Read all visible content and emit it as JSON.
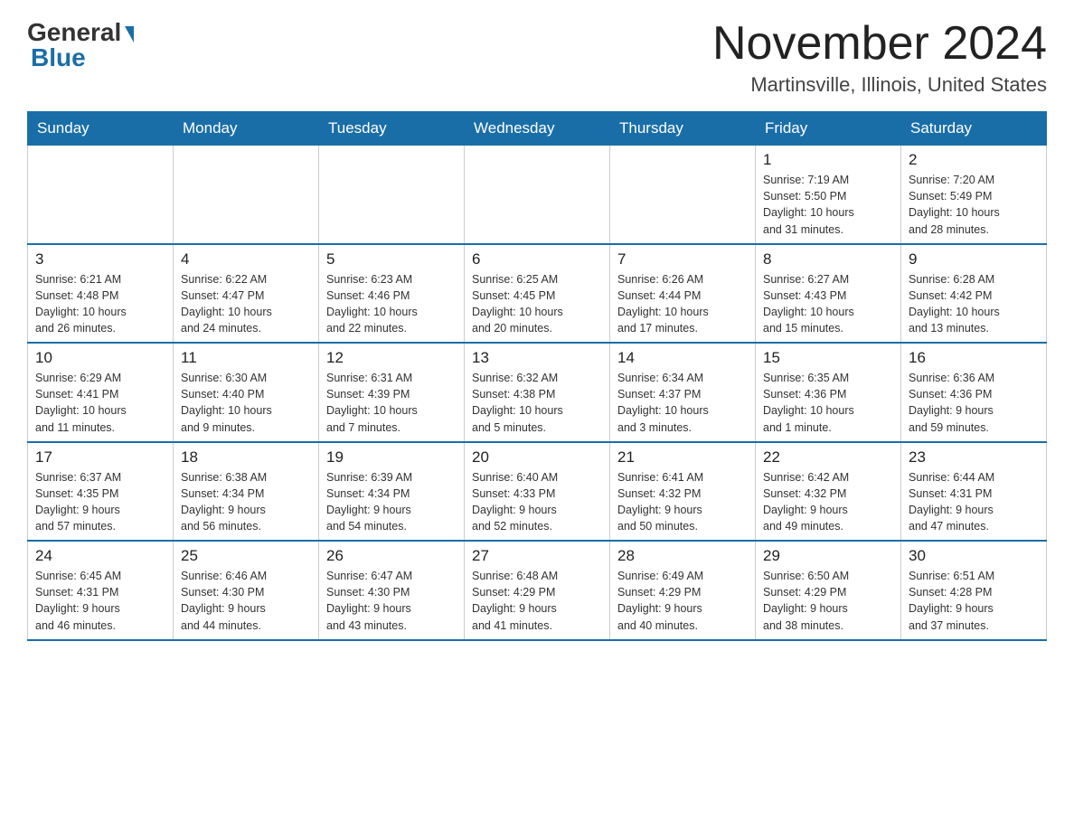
{
  "logo": {
    "general": "General",
    "blue": "Blue"
  },
  "header": {
    "month_year": "November 2024",
    "location": "Martinsville, Illinois, United States"
  },
  "weekdays": [
    "Sunday",
    "Monday",
    "Tuesday",
    "Wednesday",
    "Thursday",
    "Friday",
    "Saturday"
  ],
  "weeks": [
    [
      {
        "day": "",
        "info": ""
      },
      {
        "day": "",
        "info": ""
      },
      {
        "day": "",
        "info": ""
      },
      {
        "day": "",
        "info": ""
      },
      {
        "day": "",
        "info": ""
      },
      {
        "day": "1",
        "info": "Sunrise: 7:19 AM\nSunset: 5:50 PM\nDaylight: 10 hours\nand 31 minutes."
      },
      {
        "day": "2",
        "info": "Sunrise: 7:20 AM\nSunset: 5:49 PM\nDaylight: 10 hours\nand 28 minutes."
      }
    ],
    [
      {
        "day": "3",
        "info": "Sunrise: 6:21 AM\nSunset: 4:48 PM\nDaylight: 10 hours\nand 26 minutes."
      },
      {
        "day": "4",
        "info": "Sunrise: 6:22 AM\nSunset: 4:47 PM\nDaylight: 10 hours\nand 24 minutes."
      },
      {
        "day": "5",
        "info": "Sunrise: 6:23 AM\nSunset: 4:46 PM\nDaylight: 10 hours\nand 22 minutes."
      },
      {
        "day": "6",
        "info": "Sunrise: 6:25 AM\nSunset: 4:45 PM\nDaylight: 10 hours\nand 20 minutes."
      },
      {
        "day": "7",
        "info": "Sunrise: 6:26 AM\nSunset: 4:44 PM\nDaylight: 10 hours\nand 17 minutes."
      },
      {
        "day": "8",
        "info": "Sunrise: 6:27 AM\nSunset: 4:43 PM\nDaylight: 10 hours\nand 15 minutes."
      },
      {
        "day": "9",
        "info": "Sunrise: 6:28 AM\nSunset: 4:42 PM\nDaylight: 10 hours\nand 13 minutes."
      }
    ],
    [
      {
        "day": "10",
        "info": "Sunrise: 6:29 AM\nSunset: 4:41 PM\nDaylight: 10 hours\nand 11 minutes."
      },
      {
        "day": "11",
        "info": "Sunrise: 6:30 AM\nSunset: 4:40 PM\nDaylight: 10 hours\nand 9 minutes."
      },
      {
        "day": "12",
        "info": "Sunrise: 6:31 AM\nSunset: 4:39 PM\nDaylight: 10 hours\nand 7 minutes."
      },
      {
        "day": "13",
        "info": "Sunrise: 6:32 AM\nSunset: 4:38 PM\nDaylight: 10 hours\nand 5 minutes."
      },
      {
        "day": "14",
        "info": "Sunrise: 6:34 AM\nSunset: 4:37 PM\nDaylight: 10 hours\nand 3 minutes."
      },
      {
        "day": "15",
        "info": "Sunrise: 6:35 AM\nSunset: 4:36 PM\nDaylight: 10 hours\nand 1 minute."
      },
      {
        "day": "16",
        "info": "Sunrise: 6:36 AM\nSunset: 4:36 PM\nDaylight: 9 hours\nand 59 minutes."
      }
    ],
    [
      {
        "day": "17",
        "info": "Sunrise: 6:37 AM\nSunset: 4:35 PM\nDaylight: 9 hours\nand 57 minutes."
      },
      {
        "day": "18",
        "info": "Sunrise: 6:38 AM\nSunset: 4:34 PM\nDaylight: 9 hours\nand 56 minutes."
      },
      {
        "day": "19",
        "info": "Sunrise: 6:39 AM\nSunset: 4:34 PM\nDaylight: 9 hours\nand 54 minutes."
      },
      {
        "day": "20",
        "info": "Sunrise: 6:40 AM\nSunset: 4:33 PM\nDaylight: 9 hours\nand 52 minutes."
      },
      {
        "day": "21",
        "info": "Sunrise: 6:41 AM\nSunset: 4:32 PM\nDaylight: 9 hours\nand 50 minutes."
      },
      {
        "day": "22",
        "info": "Sunrise: 6:42 AM\nSunset: 4:32 PM\nDaylight: 9 hours\nand 49 minutes."
      },
      {
        "day": "23",
        "info": "Sunrise: 6:44 AM\nSunset: 4:31 PM\nDaylight: 9 hours\nand 47 minutes."
      }
    ],
    [
      {
        "day": "24",
        "info": "Sunrise: 6:45 AM\nSunset: 4:31 PM\nDaylight: 9 hours\nand 46 minutes."
      },
      {
        "day": "25",
        "info": "Sunrise: 6:46 AM\nSunset: 4:30 PM\nDaylight: 9 hours\nand 44 minutes."
      },
      {
        "day": "26",
        "info": "Sunrise: 6:47 AM\nSunset: 4:30 PM\nDaylight: 9 hours\nand 43 minutes."
      },
      {
        "day": "27",
        "info": "Sunrise: 6:48 AM\nSunset: 4:29 PM\nDaylight: 9 hours\nand 41 minutes."
      },
      {
        "day": "28",
        "info": "Sunrise: 6:49 AM\nSunset: 4:29 PM\nDaylight: 9 hours\nand 40 minutes."
      },
      {
        "day": "29",
        "info": "Sunrise: 6:50 AM\nSunset: 4:29 PM\nDaylight: 9 hours\nand 38 minutes."
      },
      {
        "day": "30",
        "info": "Sunrise: 6:51 AM\nSunset: 4:28 PM\nDaylight: 9 hours\nand 37 minutes."
      }
    ]
  ]
}
